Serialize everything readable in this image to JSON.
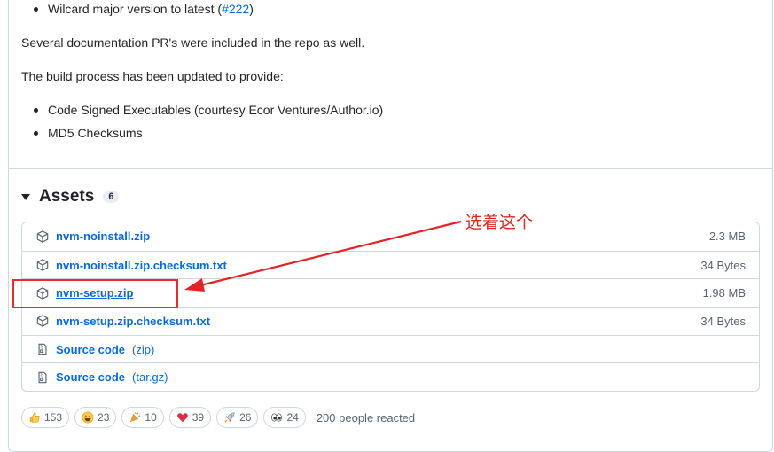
{
  "release_notes": {
    "wildcard_text": "Wilcard major version to latest (",
    "wildcard_link": "#222",
    "wildcard_close": ")",
    "docs_para": "Several documentation PR's were included in the repo as well.",
    "build_para": "The build process has been updated to provide:",
    "build_items": [
      "Code Signed Executables (courtesy Ecor Ventures/Author.io)",
      "MD5 Checksums"
    ]
  },
  "assets": {
    "title": "Assets",
    "count": "6",
    "items": [
      {
        "name": "nvm-noinstall.zip",
        "size": "2.3 MB",
        "icon": "package-icon"
      },
      {
        "name": "nvm-noinstall.zip.checksum.txt",
        "size": "34 Bytes",
        "icon": "package-icon"
      },
      {
        "name": "nvm-setup.zip",
        "size": "1.98 MB",
        "icon": "package-icon"
      },
      {
        "name": "nvm-setup.zip.checksum.txt",
        "size": "34 Bytes",
        "icon": "package-icon"
      },
      {
        "name": "Source code",
        "sub": "(zip)",
        "icon": "file-zip-icon"
      },
      {
        "name": "Source code",
        "sub": "(tar.gz)",
        "icon": "file-zip-icon"
      }
    ]
  },
  "annotation": {
    "text": "选着这个",
    "color": "#e02424"
  },
  "reactions": {
    "items": [
      {
        "emoji": "thumbs-up-icon",
        "count": "153"
      },
      {
        "emoji": "laugh-icon",
        "count": "23"
      },
      {
        "emoji": "tada-icon",
        "count": "10"
      },
      {
        "emoji": "heart-icon",
        "count": "39"
      },
      {
        "emoji": "rocket-icon",
        "count": "26"
      },
      {
        "emoji": "eyes-icon",
        "count": "24"
      }
    ],
    "summary": "200 people reacted"
  }
}
